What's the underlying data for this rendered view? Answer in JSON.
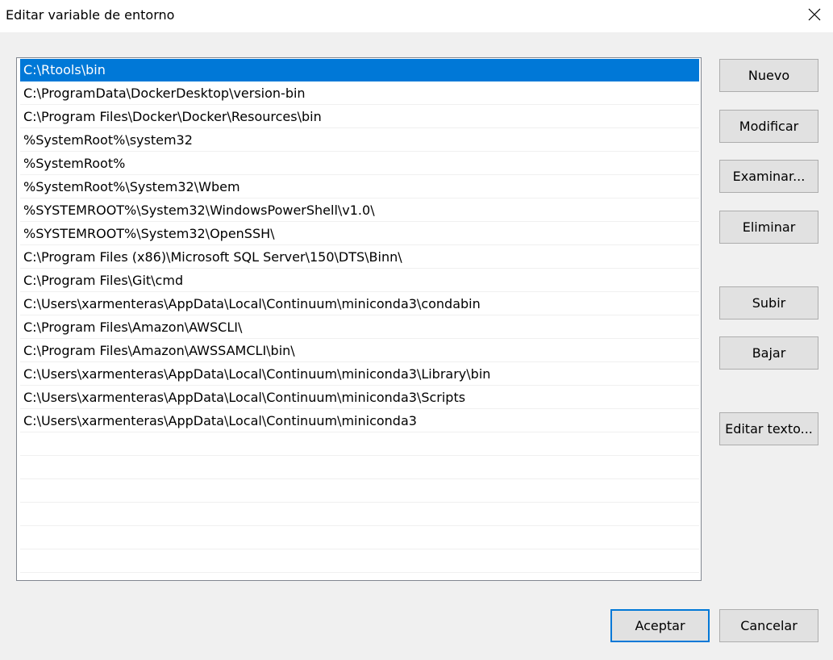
{
  "window": {
    "title": "Editar variable de entorno",
    "close_icon": "close-icon"
  },
  "list": {
    "selected_index": 0,
    "items": [
      "C:\\Rtools\\bin",
      "C:\\ProgramData\\DockerDesktop\\version-bin",
      "C:\\Program Files\\Docker\\Docker\\Resources\\bin",
      "%SystemRoot%\\system32",
      "%SystemRoot%",
      "%SystemRoot%\\System32\\Wbem",
      "%SYSTEMROOT%\\System32\\WindowsPowerShell\\v1.0\\",
      "%SYSTEMROOT%\\System32\\OpenSSH\\",
      "C:\\Program Files (x86)\\Microsoft SQL Server\\150\\DTS\\Binn\\",
      "C:\\Program Files\\Git\\cmd",
      "C:\\Users\\xarmenteras\\AppData\\Local\\Continuum\\miniconda3\\condabin",
      "C:\\Program Files\\Amazon\\AWSCLI\\",
      "C:\\Program Files\\Amazon\\AWSSAMCLI\\bin\\",
      "C:\\Users\\xarmenteras\\AppData\\Local\\Continuum\\miniconda3\\Library\\bin",
      "C:\\Users\\xarmenteras\\AppData\\Local\\Continuum\\miniconda3\\Scripts",
      "C:\\Users\\xarmenteras\\AppData\\Local\\Continuum\\miniconda3",
      "",
      "",
      "",
      "",
      "",
      "",
      ""
    ]
  },
  "buttons": {
    "new": "Nuevo",
    "edit": "Modificar",
    "browse": "Examinar...",
    "delete": "Eliminar",
    "move_up": "Subir",
    "move_down": "Bajar",
    "edit_text": "Editar texto...",
    "ok": "Aceptar",
    "cancel": "Cancelar"
  },
  "colors": {
    "selection": "#0078d7",
    "dialog_background": "#f0f0f0",
    "button_face": "#e1e1e1"
  }
}
